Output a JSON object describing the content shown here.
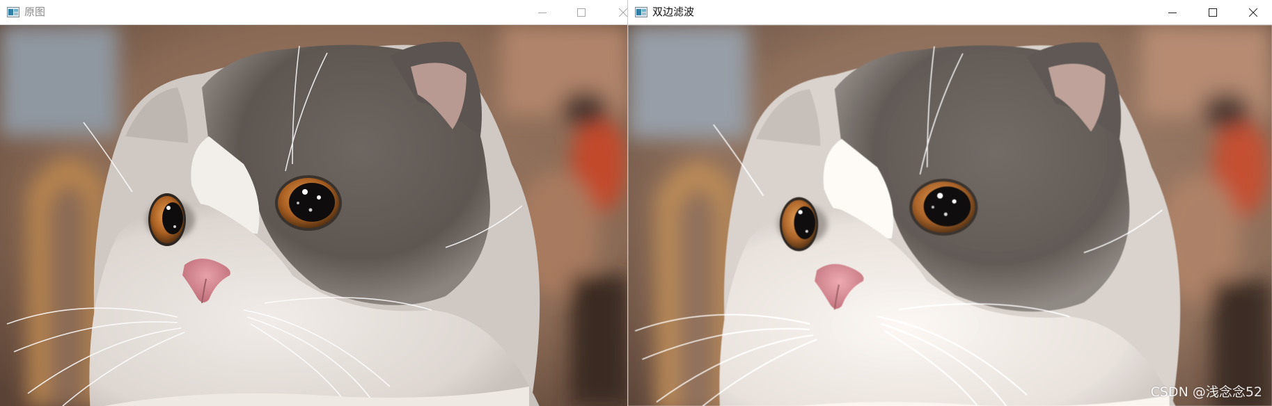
{
  "windows": [
    {
      "title": "原图",
      "active": false,
      "content": "cat-photo-original"
    },
    {
      "title": "双边滤波",
      "active": true,
      "content": "cat-photo-bilateral-filtered"
    }
  ],
  "window_controls": [
    "minimize-icon",
    "maximize-icon",
    "close-icon"
  ],
  "watermark": "CSDN @浅念念52",
  "colors": {
    "titlebar_bg": "#ffffff",
    "inactive_title": "#8a8a8a",
    "active_title": "#111111"
  }
}
